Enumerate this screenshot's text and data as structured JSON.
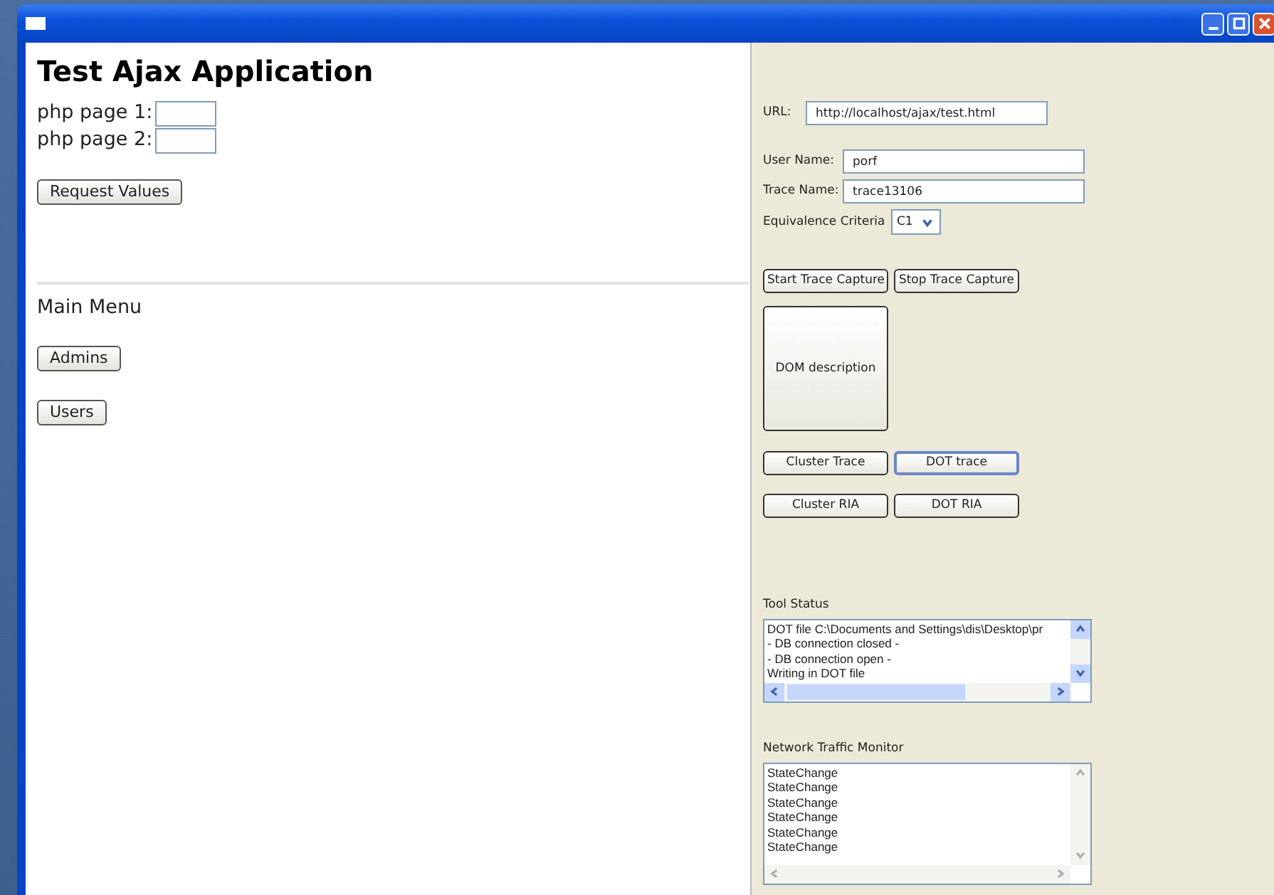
{
  "window": {
    "controls": [
      {
        "kind": "minimize"
      },
      {
        "kind": "maximize"
      },
      {
        "kind": "close"
      }
    ]
  },
  "app_page": {
    "title": "Test Ajax Application",
    "fields": [
      {
        "label": "php page 1:"
      },
      {
        "label": "php page 2:"
      }
    ],
    "request_button": "Request Values",
    "menu_title": "Main Menu",
    "menu_buttons": [
      "Admins",
      "Users"
    ]
  },
  "tool_panel": {
    "url": {
      "label": "URL:",
      "value": "http://localhost/ajax/test.html"
    },
    "user_name": {
      "label": "User Name:",
      "value": "porf"
    },
    "trace_name": {
      "label": "Trace Name:",
      "value": "trace13106"
    },
    "equivalence": {
      "label": "Equivalence Criteria",
      "value": "C1"
    },
    "capture_buttons": [
      "Start Trace Capture",
      "Stop Trace Capture"
    ],
    "dom_button": "DOM description",
    "action_buttons": [
      {
        "label": "Cluster Trace",
        "selected": false
      },
      {
        "label": "DOT trace",
        "selected": true
      },
      {
        "label": "Cluster RIA",
        "selected": false
      },
      {
        "label": "DOT RIA",
        "selected": false
      }
    ],
    "tool_status": {
      "label": "Tool Status",
      "lines": [
        "DOT file C:\\Documents and Settings\\dis\\Desktop\\pr",
        "- DB connection closed -",
        "- DB connection open -",
        "Writing in DOT file"
      ],
      "scroll_enabled": true
    },
    "network_monitor": {
      "label": "Network Traffic Monitor",
      "lines": [
        "StateChange",
        "StateChange",
        "StateChange",
        "StateChange",
        "StateChange",
        "StateChange"
      ],
      "scroll_enabled": false
    }
  }
}
